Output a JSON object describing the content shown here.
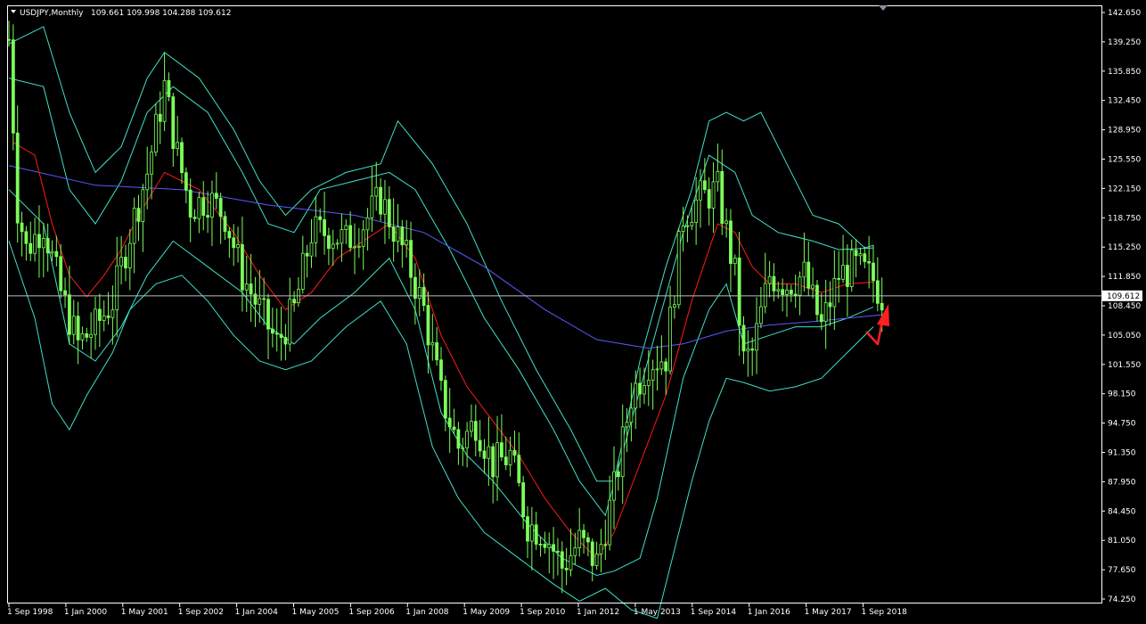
{
  "colors": {
    "background": "#000000",
    "frame": "#ffffff",
    "candle": "#7cfc5a",
    "bands": "#40e0c8",
    "ma_red": "#ff1a1a",
    "ma_blue": "#5a5aff",
    "price_line": "#c0c0c0",
    "annotation": "#ff2020"
  },
  "header": {
    "symbol": "USDJPY,Monthly",
    "ohlc": "109.661 109.998 104.288 109.612",
    "collapse_icon": "triangle-down-icon"
  },
  "chart_data": {
    "type": "candlestick",
    "symbol": "USDJPY",
    "timeframe": "Monthly",
    "ylim": [
      74.25,
      142.65
    ],
    "y_ticks": [
      "142.650",
      "139.250",
      "135.850",
      "132.450",
      "128.950",
      "125.550",
      "122.150",
      "118.750",
      "115.250",
      "111.850",
      "108.450",
      "105.050",
      "101.550",
      "98.150",
      "94.750",
      "91.350",
      "87.950",
      "84.450",
      "81.050",
      "77.650",
      "74.250"
    ],
    "x_ticks": [
      "1 Sep 1998",
      "1 Jan 2000",
      "1 May 2001",
      "1 Sep 2002",
      "1 Jan 2004",
      "1 May 2005",
      "1 Sep 2006",
      "1 Jan 2008",
      "1 May 2009",
      "1 Sep 2010",
      "1 Jan 2012",
      "1 May 2013",
      "1 Sep 2014",
      "1 Jan 2016",
      "1 May 2017",
      "1 Sep 2018"
    ],
    "current_price": "109.612",
    "close_path": [
      {
        "t": 0,
        "v": 139.5
      },
      {
        "t": 2,
        "v": 120
      },
      {
        "t": 4,
        "v": 115
      },
      {
        "t": 8,
        "v": 118
      },
      {
        "t": 12,
        "v": 110
      },
      {
        "t": 16,
        "v": 104
      },
      {
        "t": 20,
        "v": 106
      },
      {
        "t": 24,
        "v": 109
      },
      {
        "t": 28,
        "v": 117
      },
      {
        "t": 32,
        "v": 124
      },
      {
        "t": 36,
        "v": 134
      },
      {
        "t": 39,
        "v": 126
      },
      {
        "t": 42,
        "v": 120
      },
      {
        "t": 46,
        "v": 121
      },
      {
        "t": 50,
        "v": 119
      },
      {
        "t": 54,
        "v": 112
      },
      {
        "t": 58,
        "v": 108
      },
      {
        "t": 62,
        "v": 104
      },
      {
        "t": 66,
        "v": 108
      },
      {
        "t": 70,
        "v": 117
      },
      {
        "t": 74,
        "v": 117
      },
      {
        "t": 78,
        "v": 116
      },
      {
        "t": 82,
        "v": 118
      },
      {
        "t": 86,
        "v": 121
      },
      {
        "t": 92,
        "v": 114
      },
      {
        "t": 96,
        "v": 108
      },
      {
        "t": 100,
        "v": 98
      },
      {
        "t": 104,
        "v": 92
      },
      {
        "t": 108,
        "v": 95
      },
      {
        "t": 112,
        "v": 90
      },
      {
        "t": 116,
        "v": 91
      },
      {
        "t": 120,
        "v": 83
      },
      {
        "t": 124,
        "v": 82
      },
      {
        "t": 128,
        "v": 78
      },
      {
        "t": 132,
        "v": 81
      },
      {
        "t": 136,
        "v": 78.5
      },
      {
        "t": 140,
        "v": 87
      },
      {
        "t": 144,
        "v": 98
      },
      {
        "t": 148,
        "v": 102
      },
      {
        "t": 152,
        "v": 102.5
      },
      {
        "t": 156,
        "v": 119
      },
      {
        "t": 160,
        "v": 121
      },
      {
        "t": 164,
        "v": 122
      },
      {
        "t": 168,
        "v": 112
      },
      {
        "t": 170,
        "v": 102
      },
      {
        "t": 172,
        "v": 103
      },
      {
        "t": 176,
        "v": 112
      },
      {
        "t": 180,
        "v": 111
      },
      {
        "t": 184,
        "v": 112
      },
      {
        "t": 188,
        "v": 106
      },
      {
        "t": 192,
        "v": 112
      },
      {
        "t": 196,
        "v": 113
      },
      {
        "t": 200,
        "v": 111.5
      },
      {
        "t": 202,
        "v": 109.6
      }
    ],
    "ma_red": [
      {
        "t": 1,
        "v": 127.5
      },
      {
        "t": 6,
        "v": 126
      },
      {
        "t": 10,
        "v": 118
      },
      {
        "t": 14,
        "v": 112
      },
      {
        "t": 18,
        "v": 109.5
      },
      {
        "t": 22,
        "v": 112
      },
      {
        "t": 26,
        "v": 115
      },
      {
        "t": 30,
        "v": 119
      },
      {
        "t": 36,
        "v": 124
      },
      {
        "t": 44,
        "v": 122
      },
      {
        "t": 52,
        "v": 117
      },
      {
        "t": 58,
        "v": 112
      },
      {
        "t": 64,
        "v": 108
      },
      {
        "t": 70,
        "v": 110
      },
      {
        "t": 76,
        "v": 114
      },
      {
        "t": 82,
        "v": 116
      },
      {
        "t": 88,
        "v": 118
      },
      {
        "t": 94,
        "v": 114
      },
      {
        "t": 100,
        "v": 105
      },
      {
        "t": 106,
        "v": 99
      },
      {
        "t": 112,
        "v": 95
      },
      {
        "t": 118,
        "v": 91
      },
      {
        "t": 124,
        "v": 86
      },
      {
        "t": 130,
        "v": 82
      },
      {
        "t": 136,
        "v": 79
      },
      {
        "t": 140,
        "v": 82
      },
      {
        "t": 146,
        "v": 90
      },
      {
        "t": 152,
        "v": 98
      },
      {
        "t": 158,
        "v": 109
      },
      {
        "t": 164,
        "v": 118
      },
      {
        "t": 168,
        "v": 117
      },
      {
        "t": 172,
        "v": 113
      },
      {
        "t": 176,
        "v": 111
      },
      {
        "t": 182,
        "v": 111
      },
      {
        "t": 188,
        "v": 110
      },
      {
        "t": 194,
        "v": 111
      },
      {
        "t": 200,
        "v": 111.2
      }
    ],
    "ma_blue": [
      {
        "t": 0,
        "v": 124.8
      },
      {
        "t": 20,
        "v": 122.5
      },
      {
        "t": 40,
        "v": 122
      },
      {
        "t": 60,
        "v": 120.2
      },
      {
        "t": 80,
        "v": 119
      },
      {
        "t": 96,
        "v": 117
      },
      {
        "t": 110,
        "v": 113
      },
      {
        "t": 124,
        "v": 108
      },
      {
        "t": 136,
        "v": 104.5
      },
      {
        "t": 148,
        "v": 103.5
      },
      {
        "t": 156,
        "v": 104
      },
      {
        "t": 166,
        "v": 105.5
      },
      {
        "t": 176,
        "v": 106.2
      },
      {
        "t": 186,
        "v": 106.6
      },
      {
        "t": 196,
        "v": 107.1
      },
      {
        "t": 202,
        "v": 107.4
      }
    ],
    "band_upper_inner": [
      {
        "t": 0,
        "v": 135
      },
      {
        "t": 8,
        "v": 134
      },
      {
        "t": 14,
        "v": 122
      },
      {
        "t": 20,
        "v": 118
      },
      {
        "t": 26,
        "v": 123
      },
      {
        "t": 32,
        "v": 131
      },
      {
        "t": 38,
        "v": 134
      },
      {
        "t": 46,
        "v": 131
      },
      {
        "t": 54,
        "v": 124
      },
      {
        "t": 60,
        "v": 118
      },
      {
        "t": 66,
        "v": 117
      },
      {
        "t": 72,
        "v": 122
      },
      {
        "t": 80,
        "v": 123
      },
      {
        "t": 88,
        "v": 124
      },
      {
        "t": 94,
        "v": 122
      },
      {
        "t": 102,
        "v": 115
      },
      {
        "t": 110,
        "v": 107
      },
      {
        "t": 118,
        "v": 101
      },
      {
        "t": 126,
        "v": 94
      },
      {
        "t": 132,
        "v": 88
      },
      {
        "t": 138,
        "v": 84
      },
      {
        "t": 144,
        "v": 95
      },
      {
        "t": 150,
        "v": 106
      },
      {
        "t": 156,
        "v": 117
      },
      {
        "t": 162,
        "v": 126
      },
      {
        "t": 168,
        "v": 124
      },
      {
        "t": 172,
        "v": 119
      },
      {
        "t": 178,
        "v": 117
      },
      {
        "t": 186,
        "v": 116
      },
      {
        "t": 192,
        "v": 115
      },
      {
        "t": 200,
        "v": 115.2
      }
    ],
    "band_lower_inner": [
      {
        "t": 0,
        "v": 122
      },
      {
        "t": 8,
        "v": 118
      },
      {
        "t": 14,
        "v": 104
      },
      {
        "t": 20,
        "v": 102
      },
      {
        "t": 26,
        "v": 106
      },
      {
        "t": 32,
        "v": 112
      },
      {
        "t": 38,
        "v": 116
      },
      {
        "t": 46,
        "v": 113
      },
      {
        "t": 54,
        "v": 110
      },
      {
        "t": 60,
        "v": 106
      },
      {
        "t": 66,
        "v": 104
      },
      {
        "t": 72,
        "v": 107
      },
      {
        "t": 80,
        "v": 110
      },
      {
        "t": 88,
        "v": 114
      },
      {
        "t": 94,
        "v": 108
      },
      {
        "t": 100,
        "v": 96
      },
      {
        "t": 106,
        "v": 91
      },
      {
        "t": 112,
        "v": 88
      },
      {
        "t": 120,
        "v": 83
      },
      {
        "t": 128,
        "v": 79
      },
      {
        "t": 136,
        "v": 77
      },
      {
        "t": 140,
        "v": 77.5
      },
      {
        "t": 146,
        "v": 79
      },
      {
        "t": 150,
        "v": 86
      },
      {
        "t": 156,
        "v": 100
      },
      {
        "t": 162,
        "v": 108
      },
      {
        "t": 166,
        "v": 111
      },
      {
        "t": 170,
        "v": 104
      },
      {
        "t": 176,
        "v": 105
      },
      {
        "t": 182,
        "v": 106
      },
      {
        "t": 188,
        "v": 106
      },
      {
        "t": 194,
        "v": 107
      },
      {
        "t": 200,
        "v": 108.3
      }
    ],
    "band_upper_outer": [
      {
        "t": 0,
        "v": 139
      },
      {
        "t": 8,
        "v": 141
      },
      {
        "t": 14,
        "v": 131
      },
      {
        "t": 20,
        "v": 124
      },
      {
        "t": 26,
        "v": 127
      },
      {
        "t": 32,
        "v": 135
      },
      {
        "t": 36,
        "v": 138
      },
      {
        "t": 44,
        "v": 135
      },
      {
        "t": 52,
        "v": 129
      },
      {
        "t": 58,
        "v": 123
      },
      {
        "t": 64,
        "v": 119
      },
      {
        "t": 70,
        "v": 122
      },
      {
        "t": 78,
        "v": 124
      },
      {
        "t": 86,
        "v": 125
      },
      {
        "t": 90,
        "v": 130
      },
      {
        "t": 98,
        "v": 125
      },
      {
        "t": 106,
        "v": 118
      },
      {
        "t": 114,
        "v": 109
      },
      {
        "t": 122,
        "v": 101
      },
      {
        "t": 130,
        "v": 94
      },
      {
        "t": 136,
        "v": 88
      },
      {
        "t": 140,
        "v": 88
      },
      {
        "t": 146,
        "v": 102
      },
      {
        "t": 152,
        "v": 113
      },
      {
        "t": 158,
        "v": 122
      },
      {
        "t": 162,
        "v": 130
      },
      {
        "t": 166,
        "v": 131
      },
      {
        "t": 170,
        "v": 130
      },
      {
        "t": 174,
        "v": 131
      },
      {
        "t": 180,
        "v": 125
      },
      {
        "t": 186,
        "v": 119
      },
      {
        "t": 192,
        "v": 118
      },
      {
        "t": 198,
        "v": 115.2
      },
      {
        "t": 200,
        "v": 115.5
      }
    ],
    "band_lower_outer": [
      {
        "t": 0,
        "v": 116
      },
      {
        "t": 6,
        "v": 107
      },
      {
        "t": 10,
        "v": 97
      },
      {
        "t": 14,
        "v": 94
      },
      {
        "t": 18,
        "v": 98
      },
      {
        "t": 24,
        "v": 103
      },
      {
        "t": 28,
        "v": 108
      },
      {
        "t": 34,
        "v": 111
      },
      {
        "t": 40,
        "v": 112
      },
      {
        "t": 46,
        "v": 109
      },
      {
        "t": 52,
        "v": 105
      },
      {
        "t": 58,
        "v": 102
      },
      {
        "t": 64,
        "v": 101
      },
      {
        "t": 70,
        "v": 102
      },
      {
        "t": 78,
        "v": 106
      },
      {
        "t": 86,
        "v": 109
      },
      {
        "t": 92,
        "v": 104
      },
      {
        "t": 98,
        "v": 92
      },
      {
        "t": 104,
        "v": 86
      },
      {
        "t": 110,
        "v": 82
      },
      {
        "t": 118,
        "v": 79
      },
      {
        "t": 126,
        "v": 76
      },
      {
        "t": 132,
        "v": 74
      },
      {
        "t": 138,
        "v": 75.5
      },
      {
        "t": 144,
        "v": 73
      },
      {
        "t": 150,
        "v": 72
      },
      {
        "t": 158,
        "v": 88
      },
      {
        "t": 162,
        "v": 95
      },
      {
        "t": 166,
        "v": 100
      },
      {
        "t": 170,
        "v": 99.5
      },
      {
        "t": 176,
        "v": 98.5
      },
      {
        "t": 182,
        "v": 99
      },
      {
        "t": 188,
        "v": 100
      },
      {
        "t": 194,
        "v": 103
      },
      {
        "t": 200,
        "v": 106
      }
    ]
  }
}
